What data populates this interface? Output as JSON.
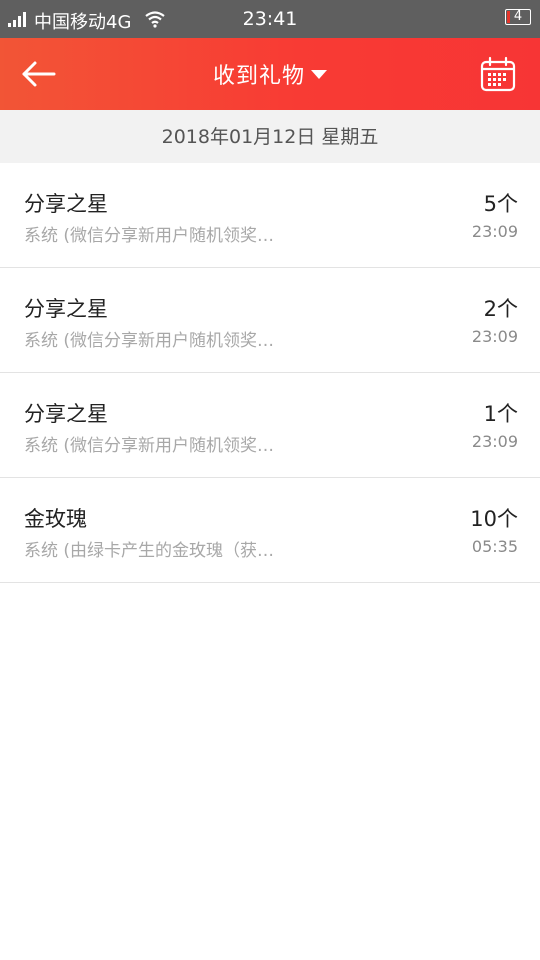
{
  "status_bar": {
    "carrier": "中国移动4G",
    "time": "23:41",
    "battery_level": "4",
    "icons": [
      "signal-icon",
      "wifi-icon",
      "battery-icon"
    ]
  },
  "nav": {
    "back_icon": "arrow-left-icon",
    "title": "收到礼物",
    "dropdown_icon": "caret-down-icon",
    "calendar_icon": "calendar-icon"
  },
  "date_header": "2018年01月12日 星期五",
  "gifts": [
    {
      "name": "分享之星",
      "description": "系统 (微信分享新用户随机领奖…",
      "count": "5个",
      "time": "23:09"
    },
    {
      "name": "分享之星",
      "description": "系统 (微信分享新用户随机领奖…",
      "count": "2个",
      "time": "23:09"
    },
    {
      "name": "分享之星",
      "description": "系统 (微信分享新用户随机领奖…",
      "count": "1个",
      "time": "23:09"
    },
    {
      "name": "金玫瑰",
      "description": "系统 (由绿卡产生的金玫瑰（获…",
      "count": "10个",
      "time": "05:35"
    }
  ],
  "colors": {
    "header_gradient_start": "#f25536",
    "header_gradient_end": "#f73535",
    "status_bar": "#5f5f5f",
    "date_bar": "#f2f2f2",
    "battery_low": "#e6362c"
  }
}
